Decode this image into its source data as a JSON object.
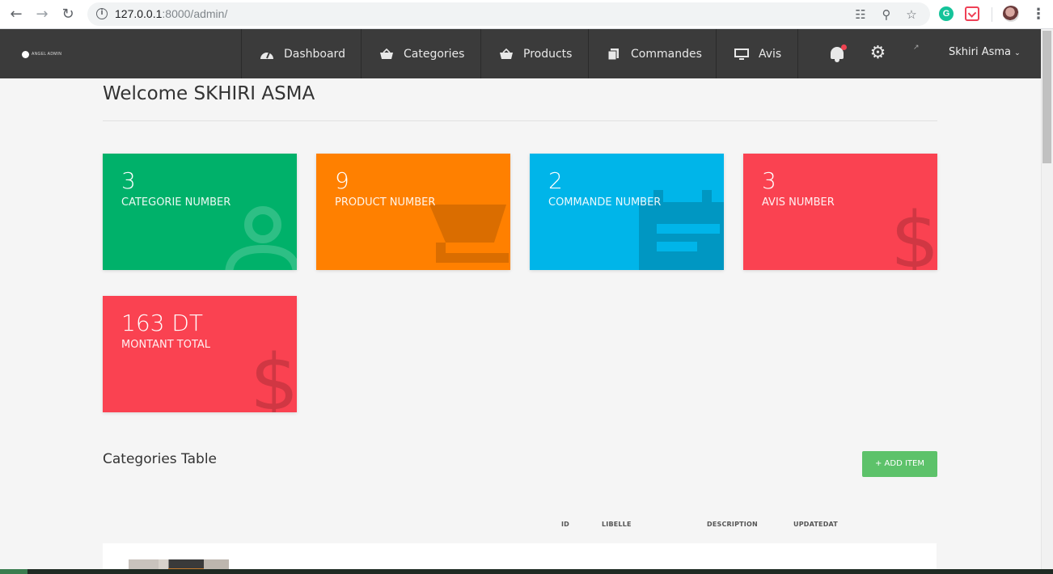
{
  "browser": {
    "url_host": "127.0.0.1",
    "url_path": ":8000/admin/",
    "back_icon": "back-arrow-icon",
    "forward_icon": "forward-arrow-icon",
    "reload_icon": "reload-icon",
    "grammarly_letter": "G"
  },
  "navbar": {
    "brand": "ANGEL ADMIN",
    "items": [
      {
        "label": "Dashboard",
        "icon": "gauge-icon"
      },
      {
        "label": "Categories",
        "icon": "basket-icon"
      },
      {
        "label": "Products",
        "icon": "basket-icon"
      },
      {
        "label": "Commandes",
        "icon": "copy-icon"
      },
      {
        "label": "Avis",
        "icon": "desktop-icon"
      }
    ],
    "user_name": "Skhiri Asma",
    "colors": {
      "background": "#3b3b3b",
      "notification_dot": "#ef4351"
    }
  },
  "page": {
    "title": "Welcome SKHIRI ASMA"
  },
  "stats": [
    {
      "value": "3",
      "label": "CATEGORIE NUMBER",
      "color": "#00b16a",
      "icon": "user-icon"
    },
    {
      "value": "9",
      "label": "PRODUCT NUMBER",
      "color": "#ff8000",
      "icon": "cart-icon"
    },
    {
      "value": "2",
      "label": "COMMANDE NUMBER",
      "color": "#00b5e9",
      "icon": "calendar-icon"
    },
    {
      "value": "3",
      "label": "AVIS NUMBER",
      "color": "#fa4251",
      "icon": "dollar-icon"
    },
    {
      "value": "163 DT",
      "label": "MONTANT TOTAL",
      "color": "#fa4251",
      "icon": "dollar-icon"
    }
  ],
  "table": {
    "title": "Categories Table",
    "add_button": "+ ADD ITEM",
    "columns": [
      "ID",
      "LIBELLE",
      "DESCRIPTION",
      "UPDATEDAT"
    ]
  }
}
